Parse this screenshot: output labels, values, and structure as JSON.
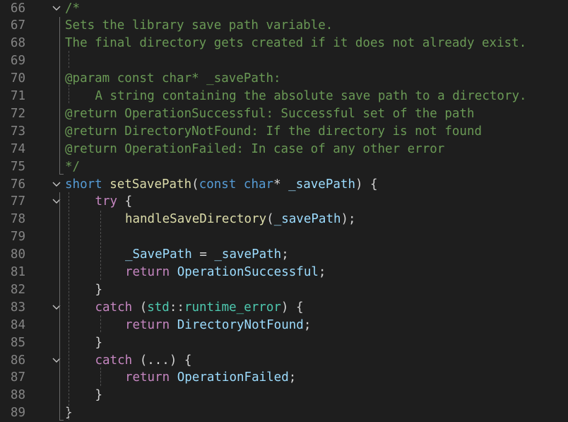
{
  "editor": {
    "line_numbers": [
      "66",
      "67",
      "68",
      "69",
      "70",
      "71",
      "72",
      "73",
      "74",
      "75",
      "76",
      "77",
      "78",
      "79",
      "80",
      "81",
      "82",
      "83",
      "84",
      "85",
      "86",
      "87",
      "88",
      "89"
    ],
    "fold_icons": {
      "66": "chevron-down",
      "76": "chevron-down",
      "77": "chevron-down",
      "83": "chevron-down",
      "86": "chevron-down"
    },
    "tokens": {
      "l66": [
        "/*"
      ],
      "l67": [
        "Sets the library save path variable."
      ],
      "l68": [
        "The final directory gets created if it does not already exist."
      ],
      "l69": [
        ""
      ],
      "l70": [
        "@param const char* _savePath:"
      ],
      "l71": [
        "A string containing the absolute save path to a directory."
      ],
      "l72": [
        "@return OperationSuccessful: Successful set of the path"
      ],
      "l73": [
        "@return DirectoryNotFound: If the directory is not found"
      ],
      "l74": [
        "@return OperationFailed: In case of any other error"
      ],
      "l75": [
        "*/"
      ],
      "l76": [
        "short",
        " ",
        "setSavePath",
        "(",
        "const",
        " ",
        "char",
        "* ",
        "_savePath",
        ") {"
      ],
      "l77": [
        "try",
        " {"
      ],
      "l78": [
        "handleSaveDirectory",
        "(",
        "_savePath",
        ");"
      ],
      "l80": [
        "_SavePath",
        " = ",
        "_savePath",
        ";"
      ],
      "l81": [
        "return",
        " ",
        "OperationSuccessful",
        ";"
      ],
      "l82": [
        "}"
      ],
      "l83": [
        "catch",
        " (",
        "std",
        "::",
        "runtime_error",
        ") {"
      ],
      "l84": [
        "return",
        " ",
        "DirectoryNotFound",
        ";"
      ],
      "l85": [
        "}"
      ],
      "l86": [
        "catch",
        " (...) {"
      ],
      "l87": [
        "return",
        " ",
        "OperationFailed",
        ";"
      ],
      "l88": [
        "}"
      ],
      "l89": [
        "}"
      ]
    }
  },
  "colors": {
    "background": "#1e1e1e",
    "line_number": "#858585",
    "comment": "#6a9955",
    "keyword": "#569cd6",
    "control": "#c586c0",
    "function": "#dcdcaa",
    "variable": "#9cdcfe",
    "type": "#4ec9b0",
    "plain": "#d4d4d4"
  }
}
